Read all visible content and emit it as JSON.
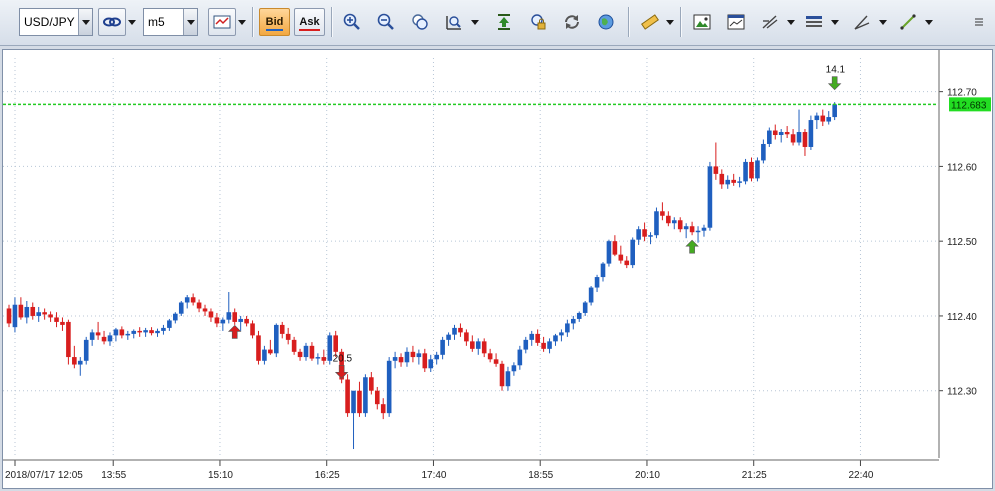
{
  "toolbar": {
    "symbol": "USD/JPY",
    "timeframe": "m5",
    "bid_label": "Bid",
    "ask_label": "Ask",
    "icons": [
      "link-icon",
      "chart-type-icon",
      "zoom-in-icon",
      "zoom-out-icon",
      "zoom-fit-icon",
      "magnifier-icon",
      "scroll-end-icon",
      "lock-icon",
      "refresh-icon",
      "globe-icon",
      "ruler-icon",
      "image-icon",
      "template-icon",
      "indicators-icon",
      "objects-icon",
      "trend-tool-icon",
      "line-tool-icon",
      "menu-icon"
    ]
  },
  "colors": {
    "up": "#1f5fbf",
    "down": "#d81e1e",
    "price_line": "#22cc22",
    "price_tag_bg": "#22dd22",
    "grid": "#b8c6d6"
  },
  "chart_data": {
    "type": "candlestick",
    "symbol": "USD/JPY",
    "timeframe": "m5",
    "current_price": "112.683",
    "ylim": [
      112.21,
      112.745
    ],
    "y_ticks": [
      "112.70",
      "112.60",
      "112.50",
      "112.40",
      "112.30"
    ],
    "x_ticks": [
      "2018/07/17 12:05",
      "13:55",
      "15:10",
      "16:25",
      "17:40",
      "18:55",
      "20:10",
      "21:25",
      "22:40"
    ],
    "annotations": [
      {
        "label": "20.5",
        "kind": "down-arrow",
        "color": "#d81e1e",
        "bar_index": 56,
        "price": 112.326
      },
      {
        "label": "",
        "kind": "up-arrow",
        "color": "#d81e1e",
        "bar_index": 38,
        "price": 112.378
      },
      {
        "label": "",
        "kind": "up-arrow",
        "color": "#44aa22",
        "bar_index": 115,
        "price": 112.492
      },
      {
        "label": "14.1",
        "kind": "down-arrow",
        "color": "#44aa22",
        "bar_index": 139,
        "price": 112.712
      }
    ],
    "candles_ohlc": [
      [
        112.41,
        112.415,
        112.385,
        112.39
      ],
      [
        112.385,
        112.425,
        112.378,
        112.415
      ],
      [
        112.415,
        112.425,
        112.395,
        112.398
      ],
      [
        112.398,
        112.42,
        112.39,
        112.412
      ],
      [
        112.412,
        112.418,
        112.395,
        112.4
      ],
      [
        112.4,
        112.412,
        112.392,
        112.405
      ],
      [
        112.405,
        112.41,
        112.395,
        112.402
      ],
      [
        112.402,
        112.406,
        112.392,
        112.398
      ],
      [
        112.398,
        112.405,
        112.385,
        112.392
      ],
      [
        112.392,
        112.398,
        112.38,
        112.388
      ],
      [
        112.392,
        112.395,
        112.335,
        112.345
      ],
      [
        112.345,
        112.36,
        112.33,
        112.335
      ],
      [
        112.335,
        112.345,
        112.32,
        112.34
      ],
      [
        112.34,
        112.372,
        112.335,
        112.368
      ],
      [
        112.368,
        112.382,
        112.36,
        112.378
      ],
      [
        112.378,
        112.392,
        112.368,
        112.374
      ],
      [
        112.372,
        112.38,
        112.362,
        112.366
      ],
      [
        112.366,
        112.378,
        112.36,
        112.374
      ],
      [
        112.374,
        112.384,
        112.366,
        112.382
      ],
      [
        112.382,
        112.386,
        112.37,
        112.374
      ],
      [
        112.374,
        112.38,
        112.368,
        112.376
      ],
      [
        112.376,
        112.382,
        112.37,
        112.38
      ],
      [
        112.38,
        112.385,
        112.372,
        112.378
      ],
      [
        112.378,
        112.384,
        112.372,
        112.381
      ],
      [
        112.381,
        112.385,
        112.374,
        112.377
      ],
      [
        112.377,
        112.383,
        112.372,
        112.38
      ],
      [
        112.38,
        112.388,
        112.375,
        112.384
      ],
      [
        112.384,
        112.396,
        112.38,
        112.394
      ],
      [
        112.394,
        112.405,
        112.39,
        112.403
      ],
      [
        112.403,
        112.42,
        112.4,
        112.418
      ],
      [
        112.418,
        112.428,
        112.41,
        112.425
      ],
      [
        112.425,
        112.43,
        112.414,
        112.418
      ],
      [
        112.418,
        112.422,
        112.405,
        112.41
      ],
      [
        112.41,
        112.415,
        112.4,
        112.406
      ],
      [
        112.406,
        112.41,
        112.392,
        112.398
      ],
      [
        112.398,
        112.404,
        112.385,
        112.39
      ],
      [
        112.39,
        112.398,
        112.38,
        112.395
      ],
      [
        112.395,
        112.432,
        112.39,
        112.405
      ],
      [
        112.405,
        112.41,
        112.388,
        112.392
      ],
      [
        112.392,
        112.4,
        112.38,
        112.396
      ],
      [
        112.396,
        112.4,
        112.386,
        112.39
      ],
      [
        112.39,
        112.394,
        112.37,
        112.374
      ],
      [
        112.374,
        112.38,
        112.335,
        112.34
      ],
      [
        112.34,
        112.36,
        112.335,
        112.355
      ],
      [
        112.355,
        112.368,
        112.348,
        112.35
      ],
      [
        112.35,
        112.39,
        112.345,
        112.388
      ],
      [
        112.388,
        112.392,
        112.37,
        112.376
      ],
      [
        112.376,
        112.384,
        112.362,
        112.368
      ],
      [
        112.368,
        112.372,
        112.348,
        112.352
      ],
      [
        112.352,
        112.356,
        112.34,
        112.345
      ],
      [
        112.345,
        112.364,
        112.34,
        112.36
      ],
      [
        112.36,
        112.365,
        112.34,
        112.343
      ],
      [
        112.343,
        112.35,
        112.335,
        112.345
      ],
      [
        112.345,
        112.355,
        112.335,
        112.34
      ],
      [
        112.34,
        112.378,
        112.335,
        112.374
      ],
      [
        112.374,
        112.38,
        112.345,
        112.352
      ],
      [
        112.352,
        112.356,
        112.31,
        112.315
      ],
      [
        112.315,
        112.322,
        112.265,
        112.27
      ],
      [
        112.27,
        112.28,
        112.222,
        112.3
      ],
      [
        112.3,
        112.312,
        112.265,
        112.27
      ],
      [
        112.27,
        112.322,
        112.265,
        112.318
      ],
      [
        112.318,
        112.325,
        112.295,
        112.3
      ],
      [
        112.3,
        112.305,
        112.275,
        112.282
      ],
      [
        112.282,
        112.29,
        112.262,
        112.27
      ],
      [
        112.27,
        112.345,
        112.265,
        112.34
      ],
      [
        112.34,
        112.352,
        112.33,
        112.345
      ],
      [
        112.345,
        112.35,
        112.332,
        112.338
      ],
      [
        112.338,
        112.358,
        112.332,
        112.352
      ],
      [
        112.352,
        112.36,
        112.338,
        112.345
      ],
      [
        112.345,
        112.355,
        112.335,
        112.35
      ],
      [
        112.35,
        112.356,
        112.325,
        112.33
      ],
      [
        112.33,
        112.348,
        112.325,
        112.342
      ],
      [
        112.342,
        112.352,
        112.335,
        112.348
      ],
      [
        112.348,
        112.372,
        112.342,
        112.368
      ],
      [
        112.368,
        112.378,
        112.36,
        112.375
      ],
      [
        112.375,
        112.388,
        112.368,
        112.384
      ],
      [
        112.384,
        112.39,
        112.372,
        112.378
      ],
      [
        112.378,
        112.382,
        112.36,
        112.366
      ],
      [
        112.366,
        112.374,
        112.352,
        112.356
      ],
      [
        112.356,
        112.37,
        112.348,
        112.366
      ],
      [
        112.366,
        112.37,
        112.345,
        112.35
      ],
      [
        112.35,
        112.356,
        112.338,
        112.342
      ],
      [
        112.342,
        112.35,
        112.332,
        112.336
      ],
      [
        112.336,
        112.34,
        112.3,
        112.306
      ],
      [
        112.306,
        112.332,
        112.3,
        112.326
      ],
      [
        112.326,
        112.338,
        112.32,
        112.334
      ],
      [
        112.334,
        112.36,
        112.328,
        112.355
      ],
      [
        112.355,
        112.372,
        112.35,
        112.368
      ],
      [
        112.368,
        112.38,
        112.36,
        112.376
      ],
      [
        112.376,
        112.382,
        112.36,
        112.364
      ],
      [
        112.364,
        112.372,
        112.352,
        112.356
      ],
      [
        112.356,
        112.37,
        112.35,
        112.366
      ],
      [
        112.366,
        112.376,
        112.36,
        112.374
      ],
      [
        112.374,
        112.382,
        112.366,
        112.378
      ],
      [
        112.378,
        112.395,
        112.372,
        112.39
      ],
      [
        112.39,
        112.4,
        112.382,
        112.396
      ],
      [
        112.396,
        112.406,
        112.392,
        112.404
      ],
      [
        112.404,
        112.42,
        112.4,
        112.418
      ],
      [
        112.418,
        112.44,
        112.414,
        112.438
      ],
      [
        112.438,
        112.455,
        112.432,
        112.452
      ],
      [
        112.452,
        112.472,
        112.446,
        112.47
      ],
      [
        112.47,
        112.502,
        112.466,
        112.5
      ],
      [
        112.5,
        112.508,
        112.48,
        112.482
      ],
      [
        112.482,
        112.494,
        112.47,
        112.474
      ],
      [
        112.474,
        112.48,
        112.464,
        112.468
      ],
      [
        112.468,
        112.505,
        112.464,
        112.502
      ],
      [
        112.502,
        112.52,
        112.495,
        112.516
      ],
      [
        112.516,
        112.525,
        112.5,
        112.506
      ],
      [
        112.506,
        112.512,
        112.496,
        112.508
      ],
      [
        112.508,
        112.545,
        112.504,
        112.54
      ],
      [
        112.54,
        112.552,
        112.528,
        112.534
      ],
      [
        112.534,
        112.54,
        112.52,
        112.524
      ],
      [
        112.524,
        112.532,
        112.516,
        112.528
      ],
      [
        112.528,
        112.532,
        112.512,
        112.516
      ],
      [
        112.516,
        112.524,
        112.504,
        112.52
      ],
      [
        112.52,
        112.526,
        112.508,
        112.512
      ],
      [
        112.512,
        112.52,
        112.498,
        112.514
      ],
      [
        112.514,
        112.522,
        112.506,
        112.518
      ],
      [
        112.518,
        112.606,
        112.514,
        112.6
      ],
      [
        112.6,
        112.632,
        112.582,
        112.59
      ],
      [
        112.59,
        112.596,
        112.57,
        112.576
      ],
      [
        112.576,
        112.588,
        112.57,
        112.582
      ],
      [
        112.582,
        112.59,
        112.574,
        112.578
      ],
      [
        112.578,
        112.586,
        112.572,
        112.58
      ],
      [
        112.58,
        112.61,
        112.576,
        112.606
      ],
      [
        112.606,
        112.612,
        112.58,
        112.584
      ],
      [
        112.584,
        112.612,
        112.58,
        112.608
      ],
      [
        112.608,
        112.636,
        112.604,
        112.63
      ],
      [
        112.63,
        112.652,
        112.626,
        112.648
      ],
      [
        112.648,
        112.656,
        112.636,
        112.642
      ],
      [
        112.642,
        112.65,
        112.632,
        112.646
      ],
      [
        112.646,
        112.654,
        112.638,
        112.643
      ],
      [
        112.643,
        112.65,
        112.628,
        112.632
      ],
      [
        112.632,
        112.676,
        112.628,
        112.646
      ],
      [
        112.646,
        112.65,
        112.614,
        112.626
      ],
      [
        112.626,
        112.668,
        112.622,
        112.662
      ],
      [
        112.662,
        112.672,
        112.65,
        112.668
      ],
      [
        112.668,
        112.676,
        112.654,
        112.66
      ],
      [
        112.66,
        112.674,
        112.656,
        112.666
      ],
      [
        112.666,
        112.686,
        112.662,
        112.683
      ]
    ]
  }
}
